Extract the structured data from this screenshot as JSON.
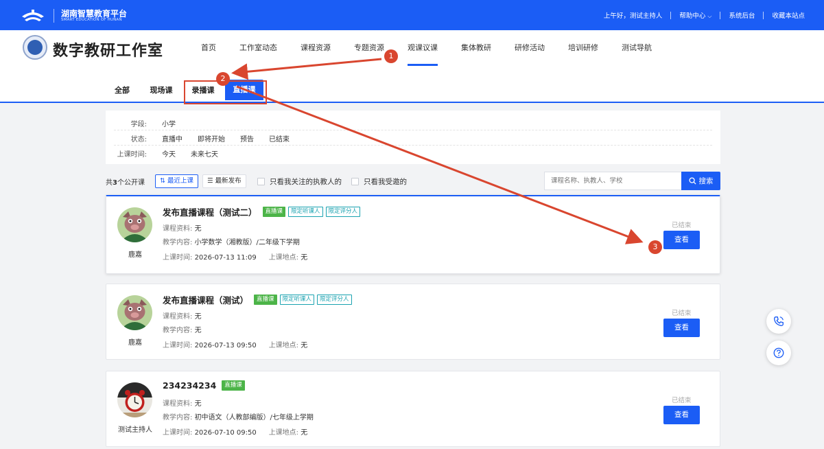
{
  "header": {
    "platform_name": "湖南智慧教育平台",
    "platform_subtitle": "SMART EDUCATION OF HUNAN",
    "greeting": "上午好，测试主持人",
    "help_center": "帮助中心",
    "admin": "系统后台",
    "bookmark": "收藏本站点"
  },
  "nav": {
    "studio_title": "数字教研工作室",
    "items": [
      {
        "label": "首页"
      },
      {
        "label": "工作室动态"
      },
      {
        "label": "课程资源"
      },
      {
        "label": "专题资源"
      },
      {
        "label": "观课议课"
      },
      {
        "label": "集体教研"
      },
      {
        "label": "研修活动"
      },
      {
        "label": "培训研修"
      },
      {
        "label": "测试导航"
      }
    ],
    "active_index": 4
  },
  "subtabs": {
    "all": "全部",
    "onsite": "现场课",
    "recorded": "录播课",
    "live": "直播课"
  },
  "filters": {
    "stage": {
      "label": "学段:",
      "options": [
        "小学"
      ]
    },
    "status": {
      "label": "状态:",
      "options": [
        "直播中",
        "即将开始",
        "预告",
        "已结束"
      ]
    },
    "time": {
      "label": "上课时间:",
      "options": [
        "今天",
        "未来七天"
      ]
    }
  },
  "toolbar": {
    "count_prefix": "共",
    "count_value": "3",
    "count_suffix": "个公开课",
    "sort_recent": "最近上课",
    "sort_new": "最新发布",
    "follow_only": "只看我关注的执教人的",
    "invited_only": "只看我受邀的",
    "search_placeholder": "课程名称、执教人、学校",
    "search_label": "搜索"
  },
  "courses": [
    {
      "title": "发布直播课程（测试二）",
      "tags": [
        "直播课",
        "限定听课人",
        "限定评分人"
      ],
      "teacher": "鹿嘉",
      "material_label": "课程资料:",
      "material": "无",
      "content_label": "教学内容:",
      "content": "小学数学（湘教版）/二年级下学期",
      "time_label": "上课时间:",
      "time": "2026-07-13 11:09",
      "place_label": "上课地点:",
      "place": "无",
      "status": "已结束",
      "view_label": "查看"
    },
    {
      "title": "发布直播课程（测试）",
      "tags": [
        "直播课",
        "限定听课人",
        "限定评分人"
      ],
      "teacher": "鹿嘉",
      "material_label": "课程资料:",
      "material": "无",
      "content_label": "教学内容:",
      "content": "无",
      "time_label": "上课时间:",
      "time": "2026-07-13 09:50",
      "place_label": "上课地点:",
      "place": "无",
      "status": "已结束",
      "view_label": "查看"
    },
    {
      "title": "234234234",
      "tags": [
        "直播课"
      ],
      "teacher": "测试主持人",
      "material_label": "课程资料:",
      "material": "无",
      "content_label": "教学内容:",
      "content": "初中语文（人教部编版）/七年级上学期",
      "time_label": "上课时间:",
      "time": "2026-07-10 09:50",
      "place_label": "上课地点:",
      "place": "无",
      "status": "已结束",
      "view_label": "查看"
    }
  ],
  "annotations": {
    "color": "#d9462f",
    "steps": [
      "1",
      "2",
      "3"
    ]
  },
  "colors": {
    "brand_blue": "#1b5df5",
    "tag_green": "#4cb448",
    "tag_cyan": "#19a2b0"
  }
}
